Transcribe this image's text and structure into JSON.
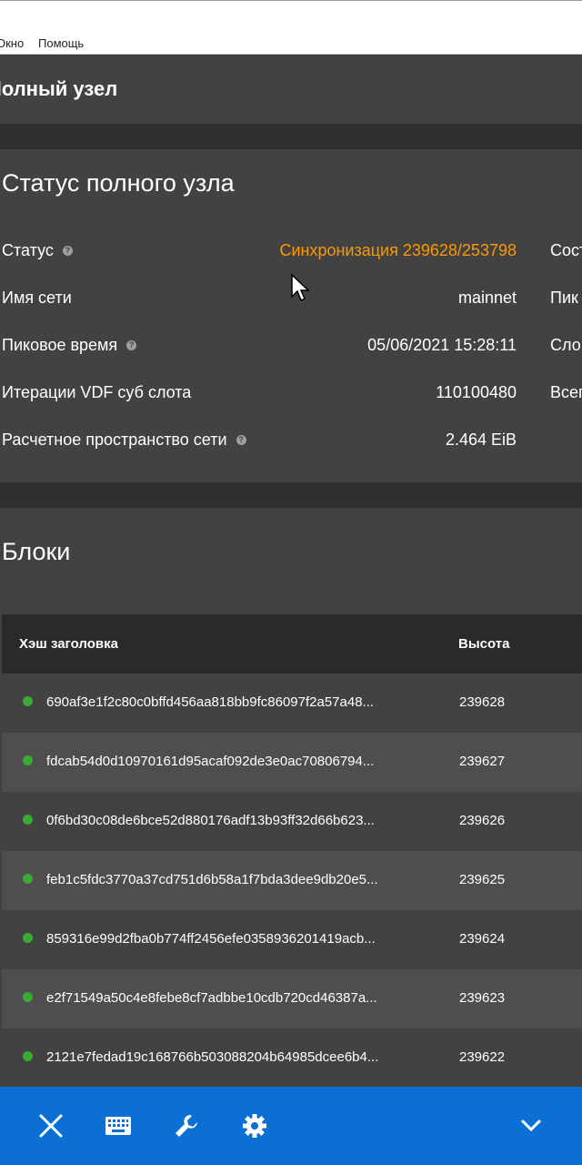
{
  "menubar": {
    "items": [
      "Окно",
      "Помощь"
    ]
  },
  "header": {
    "title": "Полный узел"
  },
  "status_card": {
    "title": "Статус полного узла",
    "rows": [
      {
        "label": "Статус",
        "value": "Синхронизация 239628/253798",
        "help": true
      },
      {
        "label": "Имя сети",
        "value": "mainnet"
      },
      {
        "label": "Пиковое время",
        "value": "05/06/2021 15:28:11",
        "help": true
      },
      {
        "label": "Итерации VDF суб слота",
        "value": "110100480"
      },
      {
        "label": "Расчетное пространство сети",
        "value": "2.464 EiB",
        "help": true
      }
    ],
    "right_column_partial": [
      "Сост",
      "Пик",
      "Сло",
      "Всег"
    ],
    "status_color": "#ff9800"
  },
  "blocks_card": {
    "title": "Блоки",
    "columns": [
      "Хэш заголовка",
      "Высота"
    ],
    "rows": [
      {
        "hash": "690af3e1f2c80c0bffd456aa818bb9fc86097f2a57a48...",
        "height": "239628"
      },
      {
        "hash": "fdcab54d0d10970161d95acaf092de3e0ac70806794...",
        "height": "239627"
      },
      {
        "hash": "0f6bd30c08de6bce52d880176adf13b93ff32d66b623...",
        "height": "239626"
      },
      {
        "hash": "feb1c5fdc3770a37cd751d6b58a1f7bda3dee9db20e5...",
        "height": "239625"
      },
      {
        "hash": "859316e99d2fba0b774ff2456efe0358936201419acb...",
        "height": "239624"
      },
      {
        "hash": "e2f71549a50c4e8febe8cf7adbbe10cdb720cd46387a...",
        "height": "239623"
      },
      {
        "hash": "2121e7fedad19c168766b503088204b64985dcee6b4...",
        "height": "239622"
      }
    ],
    "status_dot_color": "#3aaa35"
  },
  "bottombar": {
    "icons": [
      "close-icon",
      "keyboard-icon",
      "wrench-icon",
      "gear-icon",
      "chevron-down-icon"
    ],
    "color": "#0c6fd4"
  }
}
